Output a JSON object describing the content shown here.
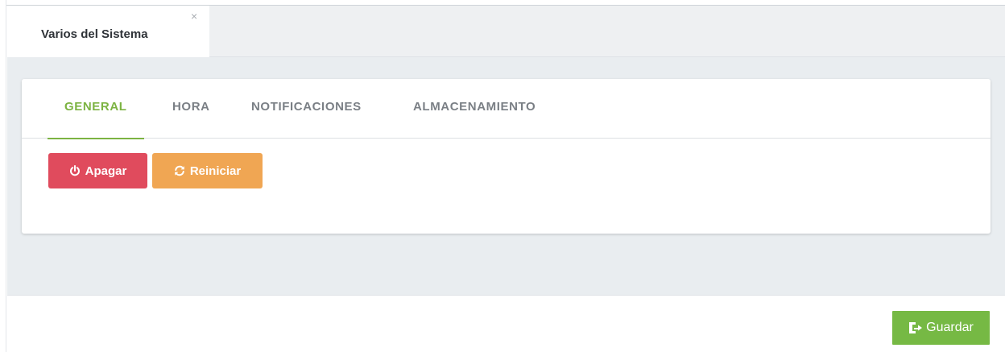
{
  "window_tab": {
    "title": "Varios del Sistema",
    "close_glyph": "×"
  },
  "panel": {
    "tabs": [
      {
        "label": "GENERAL",
        "active": true
      },
      {
        "label": "HORA",
        "active": false
      },
      {
        "label": "NOTIFICACIONES",
        "active": false
      },
      {
        "label": "ALMACENAMIENTO",
        "active": false
      }
    ],
    "actions": {
      "apagar_label": "Apagar",
      "apagar_icon": "power-icon",
      "reiniciar_label": "Reiniciar",
      "reiniciar_icon": "refresh-icon"
    }
  },
  "footer": {
    "guardar_label": "Guardar",
    "guardar_icon": "save-export-icon"
  },
  "colors": {
    "accent_green": "#7cb342",
    "danger_red": "#e04b5d",
    "warning_orange": "#f0a653",
    "save_green": "#76b944",
    "content_bg": "#e9edf0"
  }
}
